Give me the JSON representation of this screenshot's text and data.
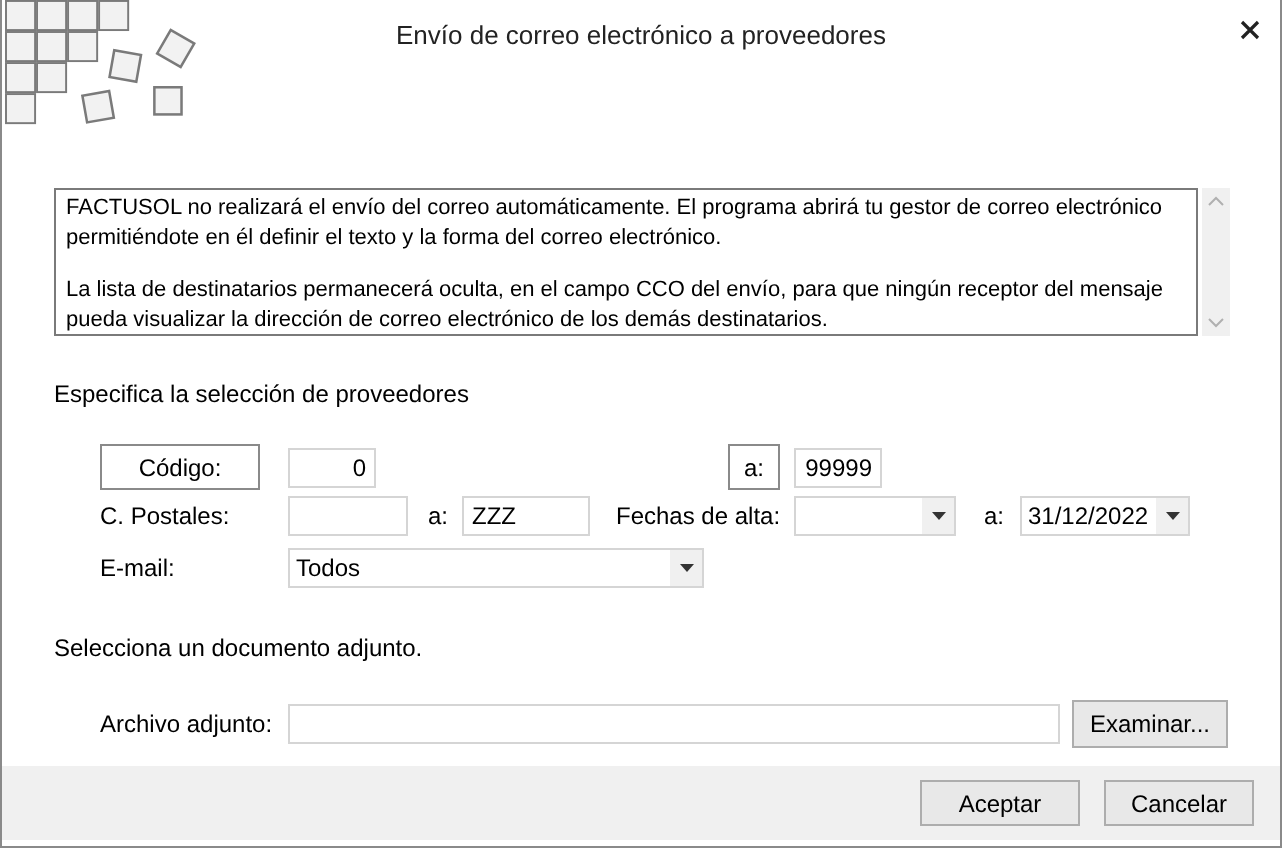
{
  "window": {
    "title": "Envío de correo electrónico a proveedores"
  },
  "message": {
    "paragraphs": [
      "FACTUSOL no realizará el envío del correo automáticamente. El programa abrirá tu gestor de correo electrónico permitiéndote en él definir el texto y la forma del correo electrónico.",
      "La lista de destinatarios permanecerá oculta, en el campo CCO del envío, para que ningún receptor del mensaje pueda visualizar la dirección de correo electrónico de los demás destinatarios."
    ]
  },
  "selection_heading": "Especifica la selección de proveedores",
  "codigo": {
    "button": "Código:",
    "from": "0",
    "to_button": "a:",
    "to": "99999"
  },
  "postales": {
    "label": "C. Postales:",
    "to_label": "a:",
    "to": "ZZZ"
  },
  "fechas": {
    "label": "Fechas de alta:",
    "to_label": "a:",
    "to": "31/12/2022"
  },
  "email": {
    "label": "E-mail:",
    "value": "Todos"
  },
  "attachment_heading": "Selecciona un documento adjunto.",
  "attachment": {
    "label": "Archivo adjunto:",
    "button": "Examinar..."
  },
  "buttons": [
    "Aceptar",
    "Cancelar"
  ]
}
